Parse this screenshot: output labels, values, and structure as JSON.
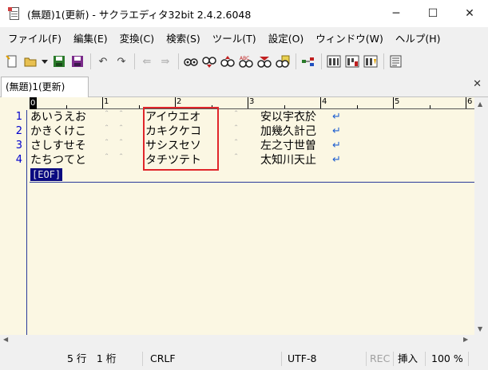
{
  "window": {
    "title": "(無題)1(更新) - サクラエディタ32bit 2.4.2.6048",
    "minimize": "─",
    "maximize": "☐",
    "close": "✕"
  },
  "menu": [
    "ファイル(F)",
    "編集(E)",
    "変換(C)",
    "検索(S)",
    "ツール(T)",
    "設定(O)",
    "ウィンドウ(W)",
    "ヘルプ(H)"
  ],
  "tab": {
    "label": "(無題)1(更新)",
    "close": "✕"
  },
  "ruler": {
    "labels": [
      "0",
      "1",
      "2",
      "3",
      "4",
      "5",
      "6"
    ]
  },
  "document": {
    "lines": [
      {
        "num": "1",
        "col1": "あいうえお",
        "col2": "アイウエオ",
        "col3": "安以宇衣於"
      },
      {
        "num": "2",
        "col1": "かきくけこ",
        "col2": "カキクケコ",
        "col3": "加幾久計己"
      },
      {
        "num": "3",
        "col1": "さしすせそ",
        "col2": "サシスセソ",
        "col3": "左之寸世曽"
      },
      {
        "num": "4",
        "col1": "たちつてと",
        "col2": "タチツテト",
        "col3": "太知川天止"
      }
    ],
    "space_mark": "＾",
    "return_mark": "↵",
    "eof": "[EOF]"
  },
  "status": {
    "position": "5 行　1 桁",
    "newline": "CRLF",
    "encoding": "UTF-8",
    "rec": "REC",
    "insert": "挿入",
    "zoom": "100 %"
  }
}
